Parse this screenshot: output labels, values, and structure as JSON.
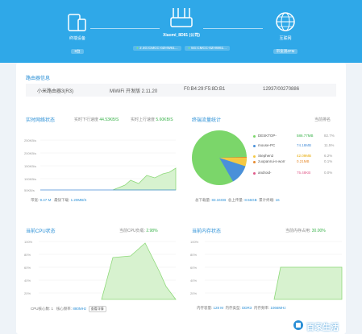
{
  "topology": {
    "device": {
      "label": "终端设备",
      "badge": "8台"
    },
    "router": {
      "name": "Xiaomi_8D81 (公司)",
      "band_24": "2.4G:CMCC-0ZHW61...",
      "band_5": "5G:CMCC-0ZHW61..."
    },
    "internet": {
      "label": "互联网",
      "badge": "带宽测4PM"
    }
  },
  "router_info": {
    "title": "路由器信息",
    "model": "小米路由器3(R3)",
    "firmware": "MiWiFi 开发版 2.11.20",
    "mac": "F0:B4:29:F5:8D:B1",
    "serial": "12937/00270886"
  },
  "network": {
    "title": "实时网络状态",
    "down_label": "实时下行速度",
    "down_value": "44.53KB/S",
    "up_label": "实时上行速度",
    "up_value": "5.60KB/S",
    "y_ticks": [
      "250KB/s",
      "200KB/s",
      "150KB/s",
      "100KB/s",
      "50KB/s"
    ],
    "footer": {
      "bw_label": "带宽:",
      "bw_value": "9.47 M",
      "peak_label": "最快下载:",
      "peak_value": "1.20MB/S"
    }
  },
  "traffic": {
    "title": "终端流量统计",
    "sort_label": "当前排名",
    "devices": [
      {
        "name": "DESKTOP-",
        "size": "586.77MB",
        "pct": "82.7%",
        "color": "#7bd66a"
      },
      {
        "name": "mouse-PC",
        "size": "74.18MB",
        "pct": "11.5%",
        "color": "#4a90d9"
      },
      {
        "name": "Stephen2",
        "size": "42.09MB",
        "pct": "6.2%",
        "color": "#f5c842"
      },
      {
        "name": "zuopanrui-s-worr",
        "size": "0.21MB",
        "pct": "0.1%",
        "color": "#e68a2e"
      },
      {
        "name": "android-",
        "size": "75.48KB",
        "pct": "0.0%",
        "color": "#e05a8a"
      }
    ],
    "footer": {
      "down_label": "总下载量:",
      "down_value": "83.34GB",
      "up_label": "总上传量:",
      "up_value": "8.56GB",
      "count_label": "累计终端:",
      "count_value": "16"
    }
  },
  "cpu": {
    "title": "当前CPU状态",
    "load_label": "当前CPU负载:",
    "load_value": "2.98%",
    "y_ticks": [
      "100%",
      "80%",
      "60%",
      "40%",
      "20%"
    ],
    "footer": {
      "cores_label": "CPU核心数:",
      "cores_value": "1",
      "freq_label": "核心频率:",
      "freq_value": "880MHz",
      "btn": "查看详情"
    }
  },
  "memory": {
    "title": "当前内存状态",
    "usage_label": "当前内存占用:",
    "usage_value": "30.00%",
    "y_ticks": [
      "100%",
      "80%",
      "60%",
      "40%",
      "20%"
    ],
    "footer": {
      "cap_label": "内存容量:",
      "cap_value": "128 M",
      "type_label": "内存类型:",
      "type_value": "DDR3",
      "freq_label": "内存频率:",
      "freq_value": "1066MHz"
    }
  },
  "watermark": "百家生活",
  "colors": {
    "accent": "#2a8fd6",
    "hero": "#2fa8e8",
    "green": "#39b24a",
    "area_fill": "#d7f2cf",
    "area_line": "#8ed97a"
  }
}
